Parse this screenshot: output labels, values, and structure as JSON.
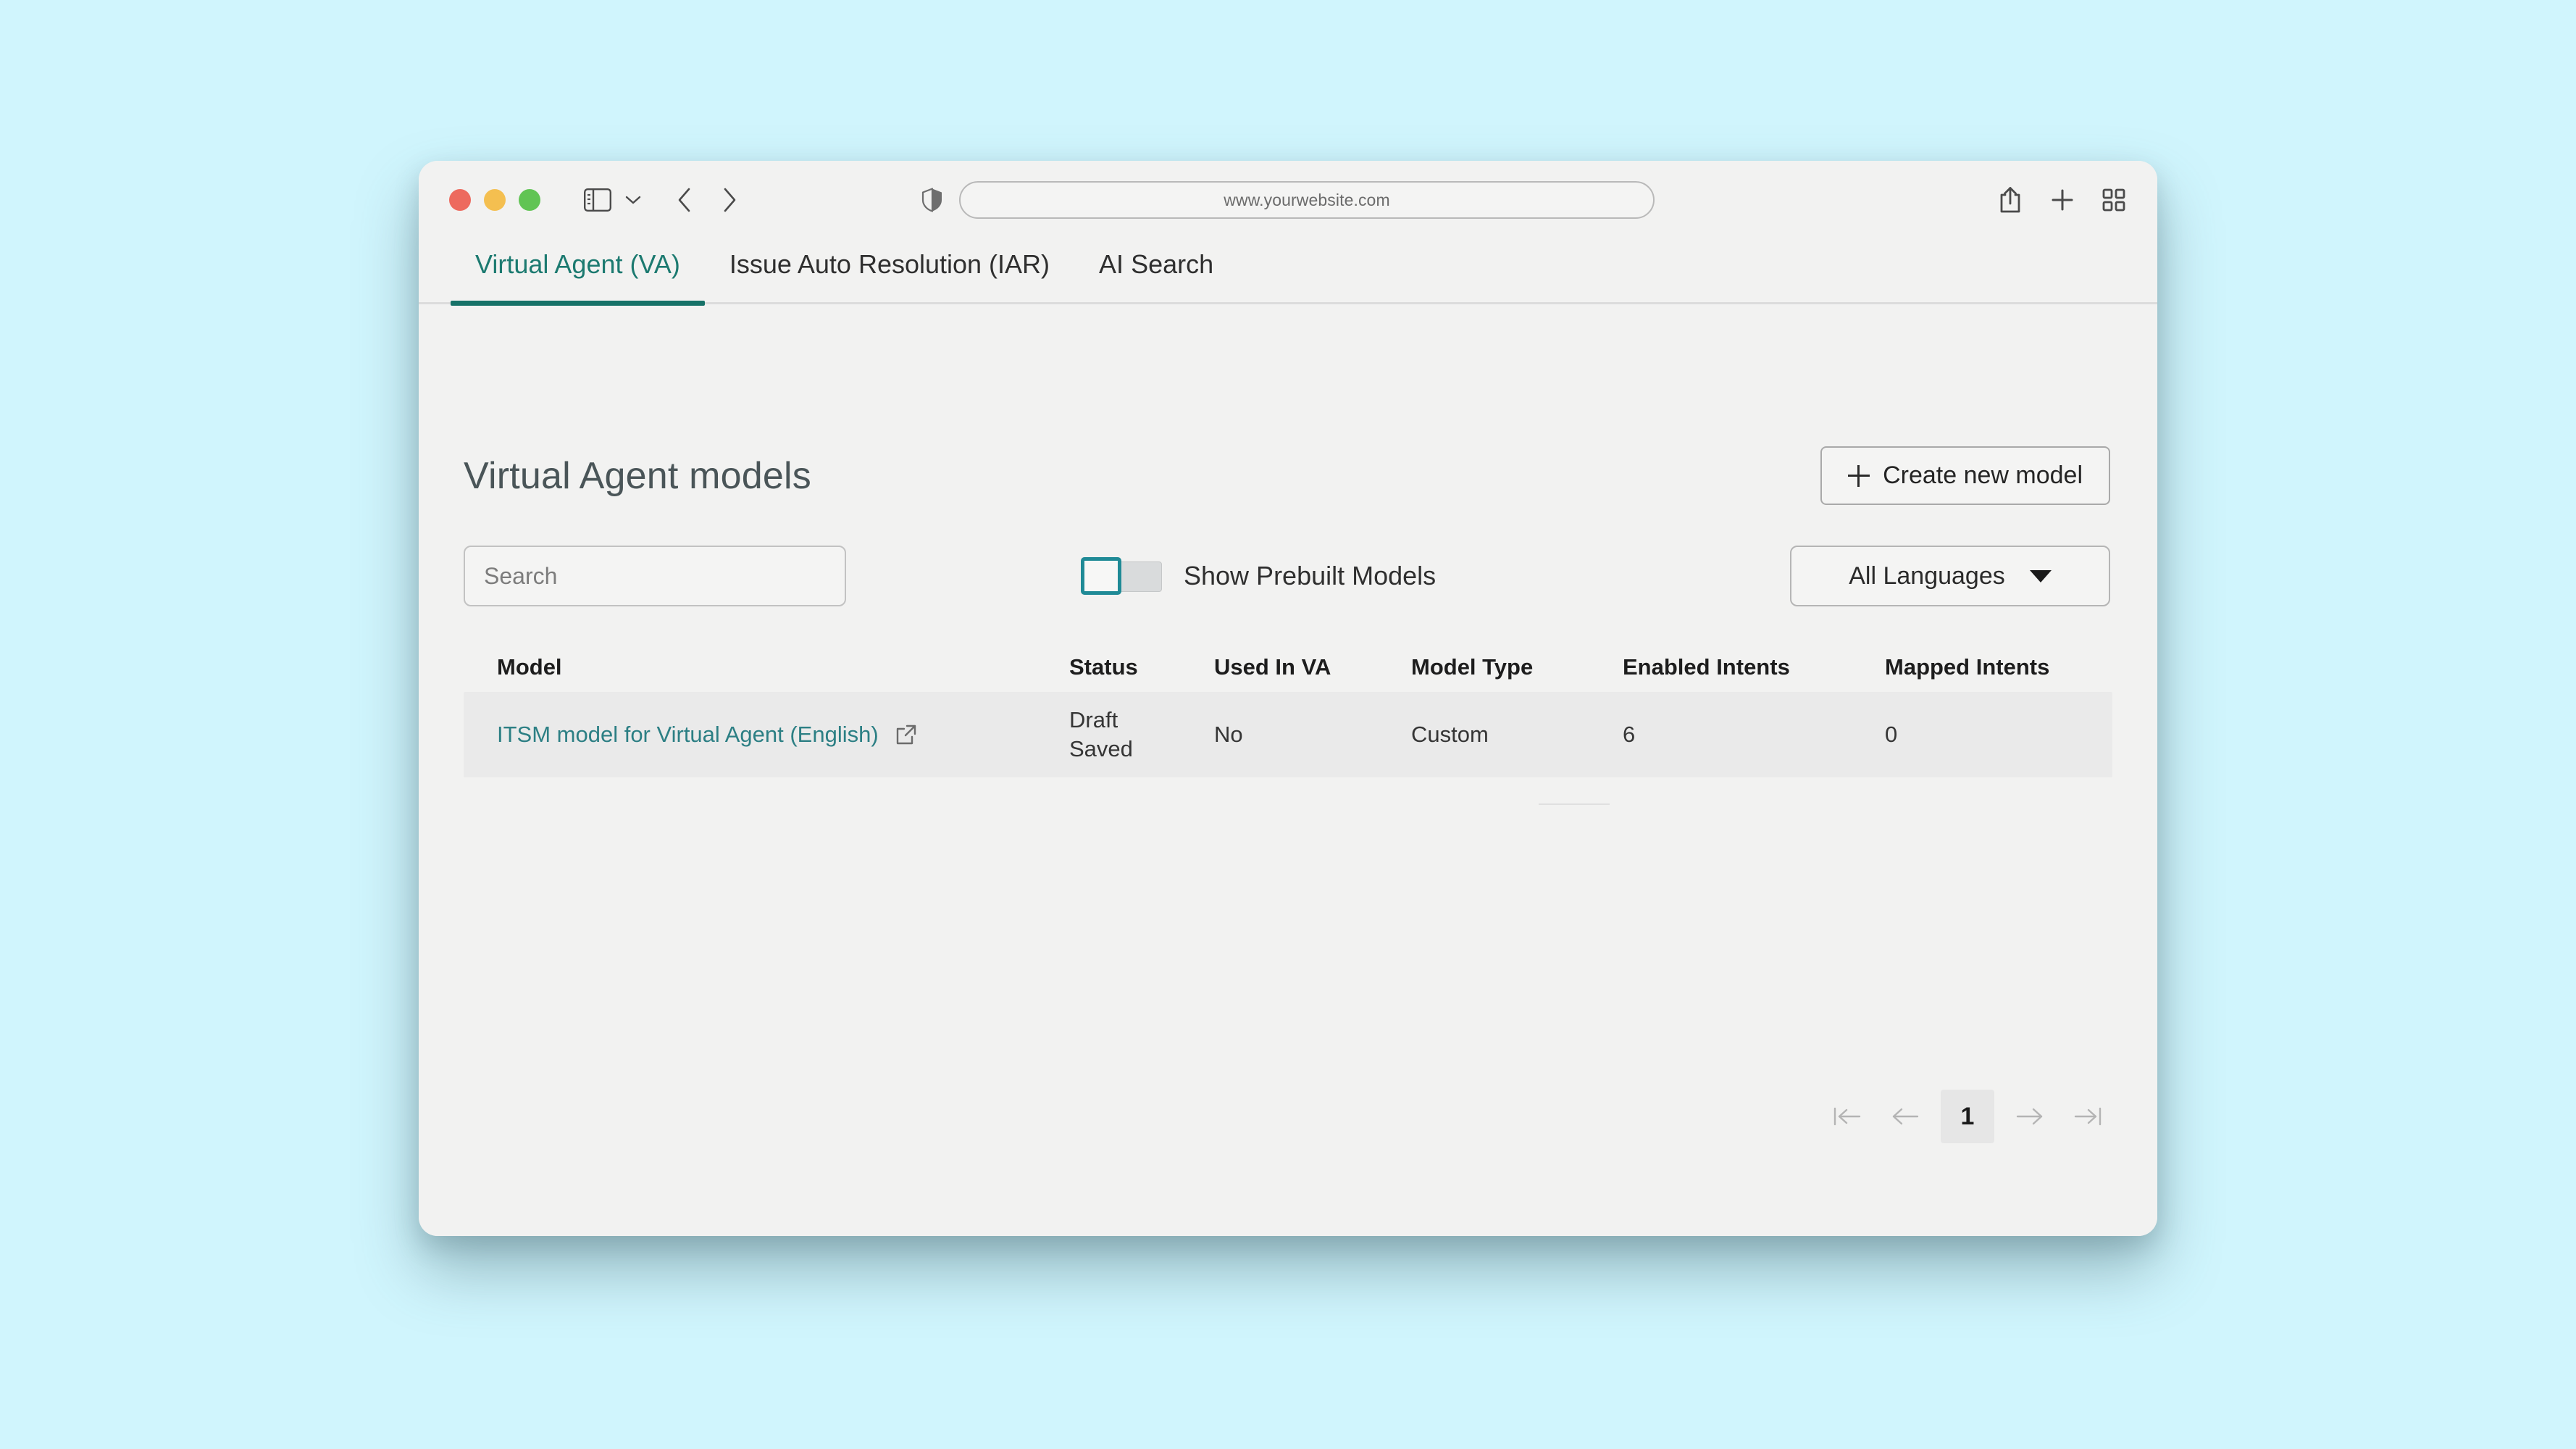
{
  "browser": {
    "url": "www.yourwebsite.com",
    "traffic_lights": [
      "close",
      "minimize",
      "zoom"
    ],
    "toolbar_icons": {
      "sidebar": "sidebar-icon",
      "sidebar_chevron": "chevron-down-icon",
      "back": "back-arrow-icon",
      "forward": "forward-arrow-icon",
      "shield": "shield-icon",
      "share": "share-icon",
      "new_tab": "plus-icon",
      "tab_overview": "tab-overview-icon"
    }
  },
  "tabs": [
    {
      "label": "Virtual Agent (VA)",
      "active": true
    },
    {
      "label": "Issue Auto Resolution (IAR)",
      "active": false
    },
    {
      "label": "AI Search",
      "active": false
    }
  ],
  "page": {
    "title": "Virtual Agent models",
    "create_button": "Create new model"
  },
  "filters": {
    "search_placeholder": "Search",
    "search_value": "",
    "toggle_label": "Show Prebuilt Models",
    "toggle_on": false,
    "language_selected": "All Languages"
  },
  "table": {
    "headers": [
      "Model",
      "Status",
      "Used In VA",
      "Model Type",
      "Enabled Intents",
      "Mapped Intents"
    ],
    "rows": [
      {
        "model": "ITSM model for Virtual Agent (English)",
        "status": "Draft Saved",
        "status_line1": "Draft",
        "status_line2": "Saved",
        "used_in_va": "No",
        "model_type": "Custom",
        "enabled_intents": "6",
        "mapped_intents": "0"
      }
    ]
  },
  "pagination": {
    "first": "first-page",
    "previous": "previous-page",
    "current_page": "1",
    "next": "next-page",
    "last": "last-page"
  },
  "colors": {
    "backdrop": "#d0f5fd",
    "accent_teal": "#177268",
    "link_teal": "#2c7f84",
    "toggle_teal": "#1f8a96",
    "window_bg": "#f2f2f1",
    "row_bg": "#eaeaea"
  }
}
